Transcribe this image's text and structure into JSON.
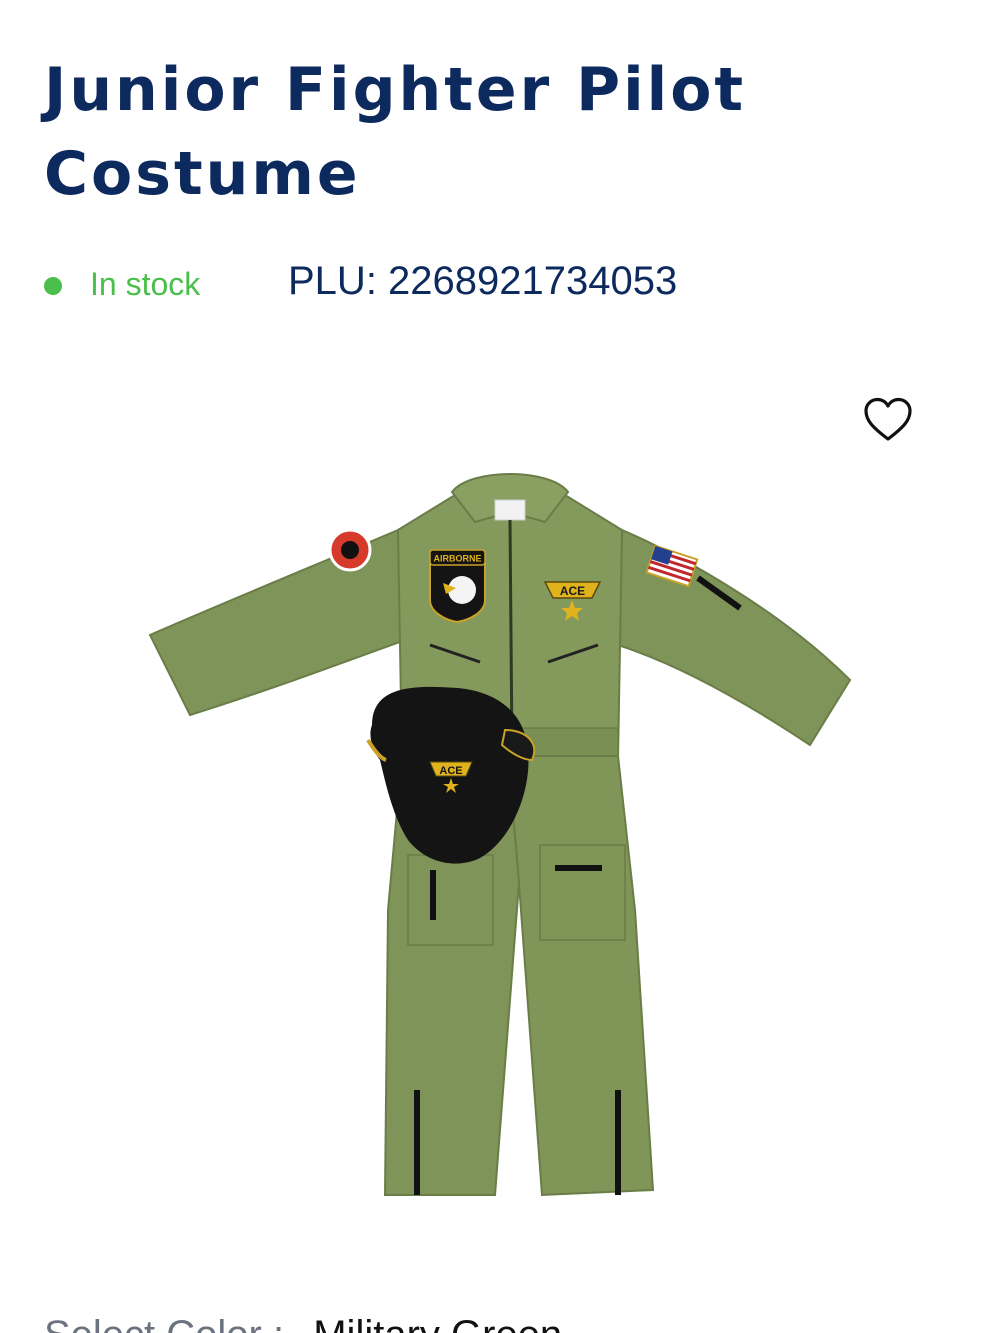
{
  "product": {
    "title_line1": "Junior Fighter Pilot",
    "title_line2": "Costume",
    "stock_status": "In stock",
    "plu": "PLU: 2268921734053"
  },
  "colors": {
    "title": "#0d2a5e",
    "in_stock": "#4bbf4b",
    "suit": "#7f9458",
    "cap": "#141414",
    "patch_gold": "#e0b21c"
  },
  "image": {
    "cap_text": "ACE",
    "chest_patch_text": "ACE",
    "sleeve_patch_text": "AIRBORNE"
  },
  "icons": {
    "wishlist": "heart-outline-icon"
  },
  "options": {
    "color_label": "Select Color :",
    "color_value": "Military Green"
  }
}
